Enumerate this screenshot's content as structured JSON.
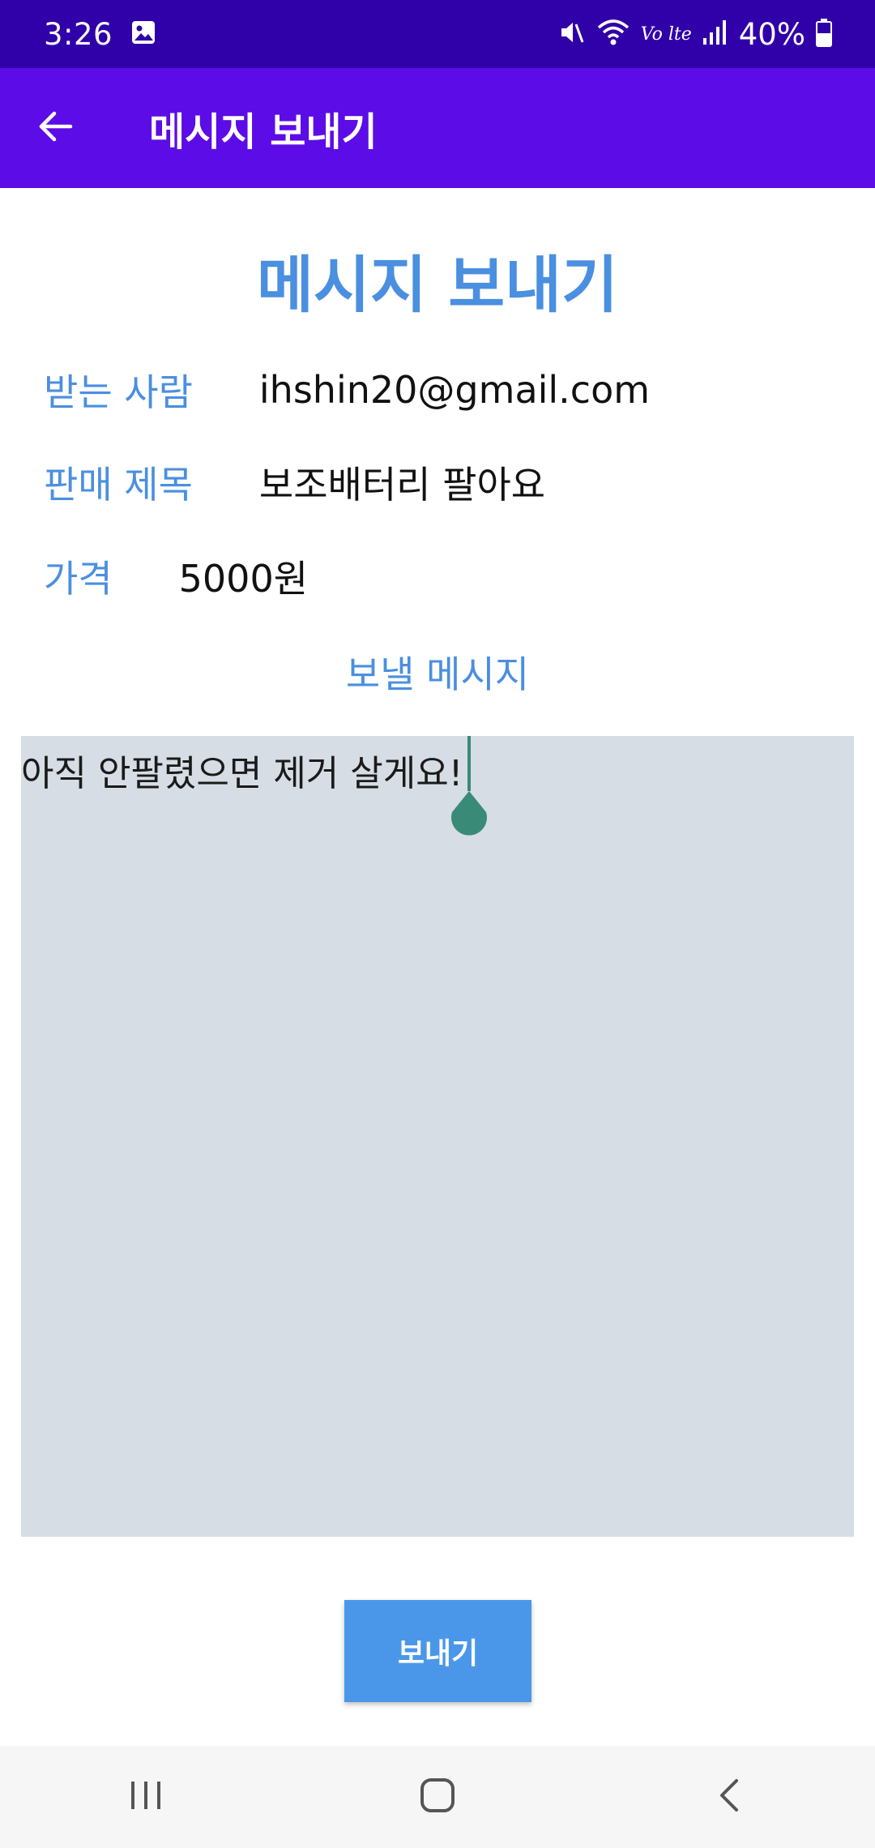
{
  "status_bar": {
    "time": "3:26",
    "network_label": "Vo lte",
    "battery": "40%"
  },
  "app_bar": {
    "title": "메시지 보내기"
  },
  "form": {
    "heading": "메시지 보내기",
    "recipient_label": "받는 사람",
    "recipient_value": "ihshin20@gmail.com",
    "sale_title_label": "판매 제목",
    "sale_title_value": "보조배터리 팔아요",
    "price_label": "가격",
    "price_value": "5000원",
    "message_label": "보낼 메시지",
    "message_text": "아직 안팔렸으면 제거 살게요!",
    "send_label": "보내기"
  },
  "colors": {
    "status_bar": "#3000a8",
    "app_bar": "#5c0ce6",
    "accent": "#4a8fe0",
    "message_bg": "#d6dde4",
    "send_button": "#4a97ea",
    "cursor": "#3a8a78"
  },
  "icons": {
    "status": [
      "gallery-icon",
      "mute-icon",
      "wifi-icon",
      "signal-icon",
      "battery-icon"
    ],
    "app_bar": [
      "back-arrow-icon"
    ],
    "nav": [
      "recent-apps-icon",
      "home-icon",
      "back-icon"
    ]
  }
}
